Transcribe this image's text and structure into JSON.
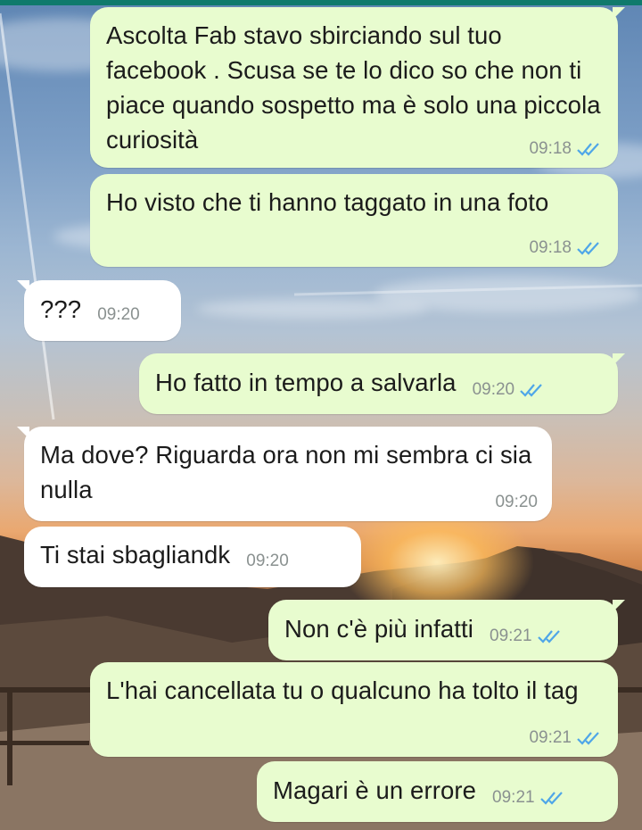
{
  "chat": {
    "messages": [
      {
        "direction": "outgoing",
        "text": "Ascolta Fab stavo sbirciando sul tuo facebook . Scusa se te lo dico so che non ti piace quando sospetto ma è solo una piccola curiosità",
        "time": "09:18",
        "status": "read"
      },
      {
        "direction": "outgoing",
        "text": "Ho visto che ti hanno taggato in una foto",
        "time": "09:18",
        "status": "read"
      },
      {
        "direction": "incoming",
        "text": "???",
        "time": "09:20"
      },
      {
        "direction": "outgoing",
        "text": "Ho fatto in tempo a salvarla",
        "time": "09:20",
        "status": "read"
      },
      {
        "direction": "incoming",
        "text": "Ma dove? Riguarda ora non mi sembra ci sia nulla",
        "time": "09:20"
      },
      {
        "direction": "incoming",
        "text": "Ti stai sbagliandk",
        "time": "09:20"
      },
      {
        "direction": "outgoing",
        "text": "Non c'è più infatti",
        "time": "09:21",
        "status": "read"
      },
      {
        "direction": "outgoing",
        "text": "L'hai cancellata tu o qualcuno ha tolto il tag",
        "time": "09:21",
        "status": "read"
      },
      {
        "direction": "outgoing",
        "text": "Magari è un errore",
        "time": "09:21",
        "status": "read"
      }
    ]
  },
  "colors": {
    "outgoing_bubble": "#e8fccf",
    "incoming_bubble": "#ffffff",
    "read_check": "#4fa6e8",
    "time_text": "#8a9190",
    "top_bar": "#0f7a6c"
  },
  "icons": {
    "read_status": "double-check-icon"
  }
}
